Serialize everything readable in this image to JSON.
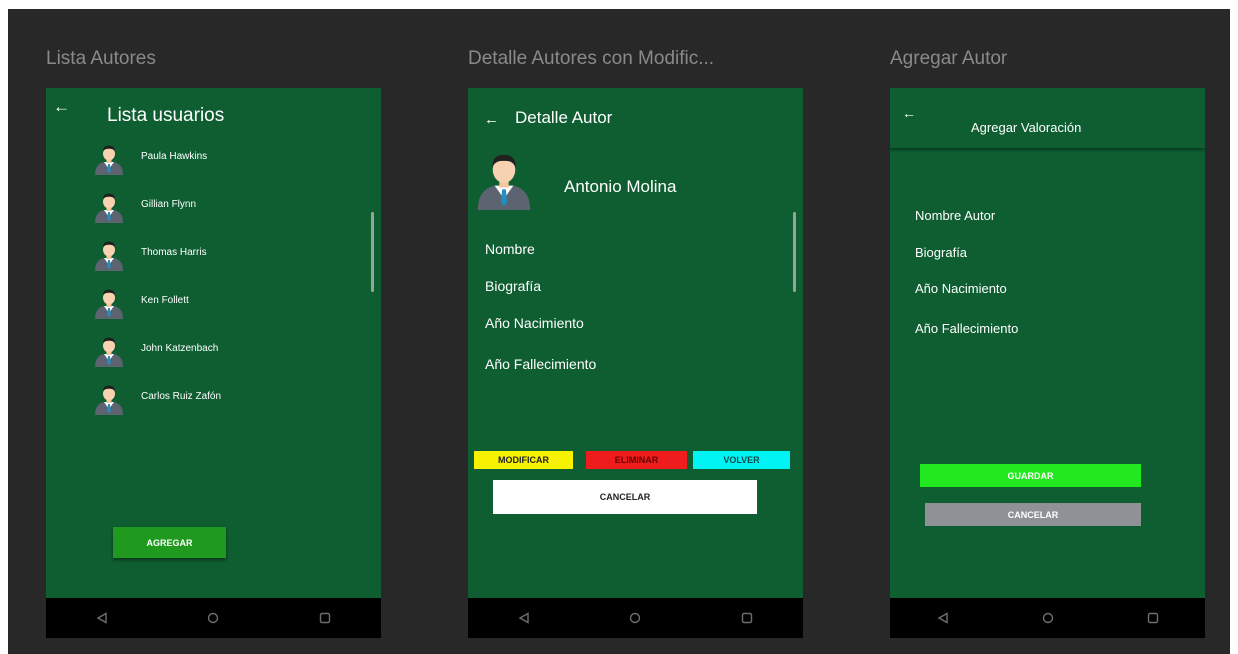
{
  "frames": {
    "f1": {
      "title": "Lista Autores",
      "header": "Lista usuarios",
      "authors": [
        "Paula Hawkins",
        "Gillian Flynn",
        "Thomas Harris",
        "Ken Follett",
        "John Katzenbach",
        "Carlos Ruiz Zafón"
      ],
      "add_label": "AGREGAR"
    },
    "f2": {
      "title": "Detalle Autores con Modific...",
      "header": "Detalle Autor",
      "author_name": "Antonio Molina",
      "fields": [
        "Nombre",
        "Biografía",
        "Año Nacimiento",
        "Año Fallecimiento"
      ],
      "modify_label": "MODIFICAR",
      "delete_label": "ELIMINAR",
      "back_label": "VOLVER",
      "cancel_label": "CANCELAR"
    },
    "f3": {
      "title": "Agregar Autor",
      "header": "Agregar Valoración",
      "fields": [
        "Nombre  Autor",
        "Biografía",
        "Año Nacimiento",
        "Año Fallecimiento"
      ],
      "save_label": "GUARDAR",
      "cancel_label": "CANCELAR"
    }
  },
  "icons": {
    "back": "arrow-left-icon",
    "nav": [
      "triangle-back-icon",
      "circle-home-icon",
      "square-recents-icon"
    ],
    "avatar": "businessman-avatar-icon"
  },
  "colors": {
    "screen_bg": "#0e5e32",
    "canvas_bg": "#282828",
    "modify": "#f6f200",
    "delete": "#ee1c1c",
    "back": "#00f4f4",
    "save": "#22e81f",
    "cancel_grey": "#8e9296",
    "add": "#1f9a1f"
  }
}
